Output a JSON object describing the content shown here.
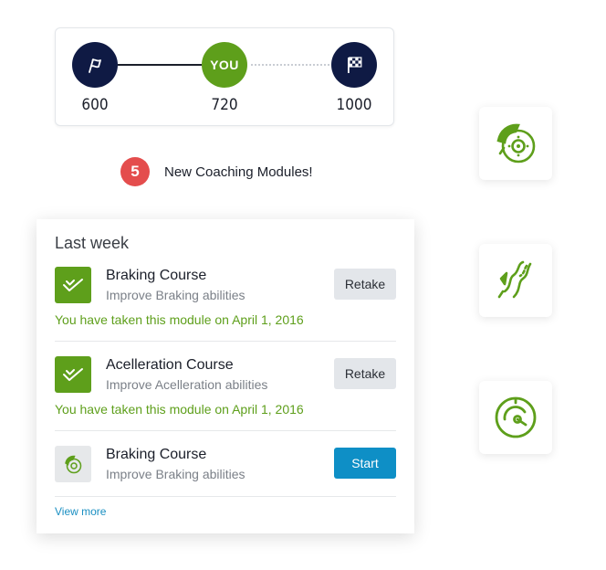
{
  "progress": {
    "start_icon": "flag-icon",
    "you_label": "YOU",
    "finish_icon": "checkered-flag-icon",
    "scores": {
      "start": "600",
      "current": "720",
      "goal": "1000"
    },
    "colors": {
      "navy": "#0f1a44",
      "green": "#5e9f1b"
    }
  },
  "notification": {
    "count": "5",
    "text": "New Coaching Modules!",
    "badge_color": "#e44d4d"
  },
  "last_week": {
    "title": "Last week",
    "modules": [
      {
        "title": "Braking Course",
        "subtitle": "Improve Braking abilities",
        "button": "Retake",
        "note": "You have taken this module on April 1, 2016",
        "icon": "checkmark-icon"
      },
      {
        "title": "Acelleration Course",
        "subtitle": "Improve Acelleration abilities",
        "button": "Retake",
        "note": "You have taken this module on April 1, 2016",
        "icon": "checkmark-icon"
      },
      {
        "title": "Braking Course",
        "subtitle": "Improve Braking abilities",
        "button": "Start",
        "icon": "brake-disc-icon"
      }
    ],
    "view_more": "View more",
    "accent": "#0e8fc6"
  },
  "tiles": [
    {
      "icon": "brake-disc-icon"
    },
    {
      "icon": "winding-road-icon"
    },
    {
      "icon": "speedometer-icon"
    }
  ]
}
